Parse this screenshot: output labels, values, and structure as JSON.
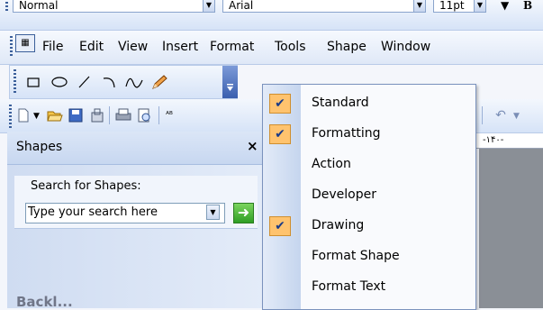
{
  "formatting_bar": {
    "style_value": "Normal",
    "font_value": "Arial",
    "size_value": "11pt",
    "bold_label": "B"
  },
  "menu_bar": {
    "items": [
      {
        "label": "File"
      },
      {
        "label": "Edit"
      },
      {
        "label": "View"
      },
      {
        "label": "Insert"
      },
      {
        "label": "Format"
      },
      {
        "label": "Tools"
      },
      {
        "label": "Shape"
      },
      {
        "label": "Window"
      }
    ]
  },
  "drawing_toolbar": {
    "icons": [
      "rectangle-icon",
      "ellipse-icon",
      "line-icon",
      "arc-icon",
      "freeform-icon",
      "pencil-icon",
      "toolbar-options-icon"
    ]
  },
  "standard_toolbar": {
    "icons": [
      "new-icon",
      "open-icon",
      "save-icon",
      "permission-icon",
      "print-icon",
      "print-preview-icon",
      "spelling-icon",
      "undo-icon"
    ]
  },
  "ruler": {
    "label": "-۱۴۰-"
  },
  "shapes_pane": {
    "title": "Shapes",
    "close_label": "×",
    "search_label": "Search for Shapes:",
    "search_placeholder": "Type your search here",
    "footer_text": "Backl..."
  },
  "toolbar_menu": {
    "items": [
      {
        "label": "Standard",
        "checked": true
      },
      {
        "label": "Formatting",
        "checked": true
      },
      {
        "label": "Action",
        "checked": false
      },
      {
        "label": "Developer",
        "checked": false
      },
      {
        "label": "Drawing",
        "checked": true
      },
      {
        "label": "Format Shape",
        "checked": false
      },
      {
        "label": "Format Text",
        "checked": false
      }
    ],
    "check_glyph": "✔"
  },
  "colors": {
    "accent_check": "#ffc36e",
    "menu_border": "#7a92bd",
    "toolbar_gradient": "#d6e3f7"
  }
}
